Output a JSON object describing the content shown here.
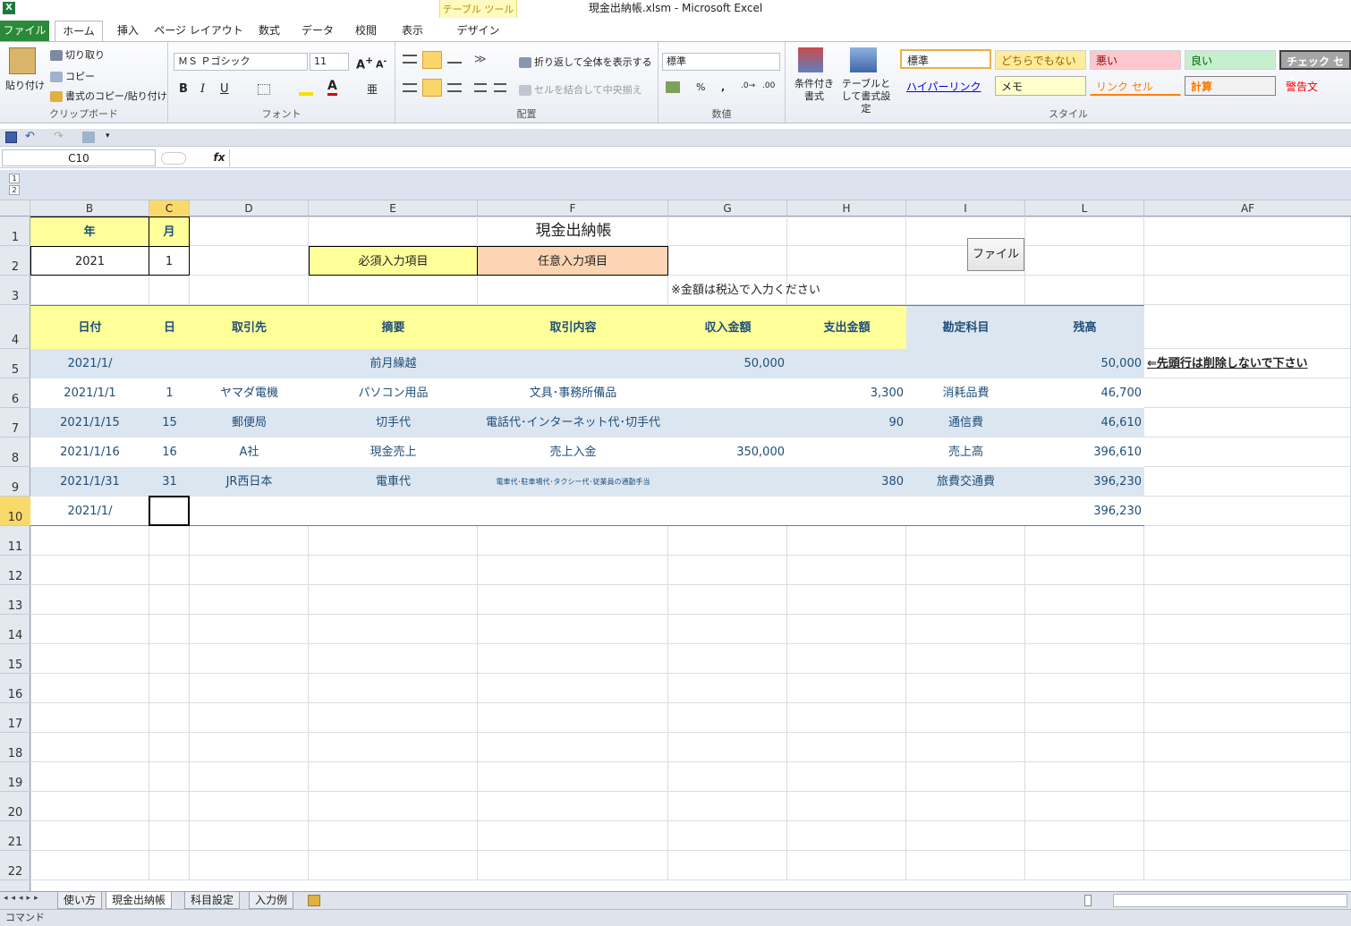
{
  "window_title": "現金出納帳.xlsm  -  Microsoft Excel",
  "ribbon_tabs": [
    "ファイル",
    "ホーム",
    "挿入",
    "ページ レイアウト",
    "数式",
    "データ",
    "校閲",
    "表示",
    "デザイン"
  ],
  "table_tools_label": "テーブル ツール",
  "clipboard": {
    "paste": "貼り付け",
    "cut": "切り取り",
    "copy": "コピー",
    "format_painter": "書式のコピー/貼り付け",
    "label": "クリップボード"
  },
  "font": {
    "name": "ＭＳ Ｐゴシック",
    "size": "11",
    "label": "フォント"
  },
  "alignment": {
    "wrap": "折り返して全体を表示する",
    "merge": "セルを結合して中央揃え",
    "label": "配置"
  },
  "number": {
    "format": "標準",
    "percent": "%",
    "comma": ",",
    "label": "数値"
  },
  "styles_group": {
    "conditional": "条件付き書式",
    "table_format": "テーブルとして書式設定",
    "label": "スタイル",
    "cells": [
      "標準",
      "どちらでもない",
      "悪い",
      "良い",
      "チェック セル",
      "ハイパーリンク",
      "メモ",
      "リンク セル",
      "計算",
      "警告文"
    ],
    "colors": {
      "neutral": "#ffeb9c",
      "bad": "#ffc7ce",
      "good": "#c6efce",
      "check": "#a5a5a5"
    }
  },
  "namebox": "C10",
  "fx_symbol": "fx",
  "outline_levels": [
    "1",
    "2"
  ],
  "columns": [
    "B",
    "C",
    "D",
    "E",
    "F",
    "G",
    "H",
    "I",
    "L",
    "AF"
  ],
  "rows": [
    "1",
    "2",
    "3",
    "4",
    "5",
    "6",
    "7",
    "8",
    "9",
    "10",
    "11",
    "12",
    "13",
    "14",
    "15",
    "16",
    "17",
    "18",
    "19",
    "20",
    "21",
    "22"
  ],
  "sheet": {
    "year_label": "年",
    "month_label": "月",
    "year": "2021",
    "month": "1",
    "title": "現金出納帳",
    "required": "必須入力項目",
    "optional": "任意入力項目",
    "note": "※金額は税込で入力ください",
    "file_button": "ファイル",
    "headers": [
      "日付",
      "日",
      "取引先",
      "摘要",
      "取引内容",
      "収入金額",
      "支出金額",
      "勘定科目",
      "残高"
    ],
    "data_rows": [
      [
        "2021/1/",
        "",
        "",
        "前月繰越",
        "",
        "50,000",
        "",
        "",
        "50,000"
      ],
      [
        "2021/1/1",
        "1",
        "ヤマダ電機",
        "パソコン用品",
        "文具･事務所備品",
        "",
        "3,300",
        "消耗品費",
        "46,700"
      ],
      [
        "2021/1/15",
        "15",
        "郵便局",
        "切手代",
        "電話代･インターネット代･切手代",
        "",
        "90",
        "通信費",
        "46,610"
      ],
      [
        "2021/1/16",
        "16",
        "A社",
        "現金売上",
        "売上入金",
        "350,000",
        "",
        "売上高",
        "396,610"
      ],
      [
        "2021/1/31",
        "31",
        "JR西日本",
        "電車代",
        "電車代･駐車場代･タクシー代･従業員の通勤手当",
        "",
        "380",
        "旅費交通費",
        "396,230"
      ],
      [
        "2021/1/",
        "",
        "",
        "",
        "",
        "",
        "",
        "",
        "396,230"
      ]
    ],
    "warning": "⇐先頭行は削除しないで下さい"
  },
  "sheet_tabs": [
    "使い方",
    "現金出納帳",
    "科目設定",
    "入力例"
  ],
  "status": "コマンド"
}
